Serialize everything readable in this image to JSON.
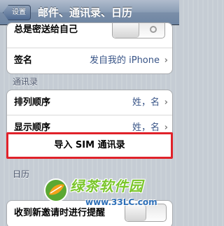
{
  "navbar": {
    "back_label": "设置",
    "title": "邮件、通讯录、日历"
  },
  "mail_group": {
    "always_bcc_label": "总是密送给自己",
    "always_bcc_on": false,
    "signature_label": "签名",
    "signature_value": "发自我的 iPhone"
  },
  "contacts": {
    "header": "通讯录",
    "sort_order_label": "排列顺序",
    "sort_order_value": "姓，名",
    "display_order_label": "显示顺序",
    "display_order_value": "姓，名",
    "import_sim_label": "导入 SIM 通讯录"
  },
  "calendar": {
    "header": "日历",
    "invite_alerts_label": "收到新邀请时进行提醒"
  },
  "watermark": {
    "title": "绿茶软件园",
    "url": "www.33LC.com"
  },
  "colors": {
    "highlight_border": "#e0222a",
    "value_blue": "#385487"
  }
}
